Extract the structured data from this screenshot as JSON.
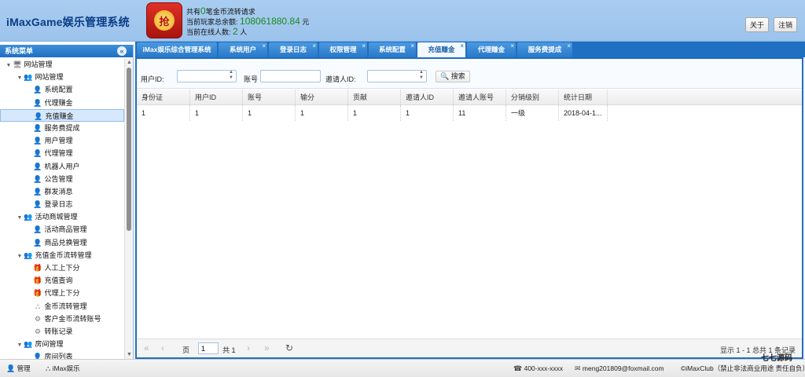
{
  "header": {
    "title": "iMaxGame娱乐管理系统",
    "logo_char": "抢",
    "stats": {
      "line1_prefix": "共有",
      "line1_num": "0",
      "line1_suffix": "笔金币流转请求",
      "line2_prefix": "当前玩家总余额:",
      "line2_num": "108061880.84",
      "line2_suffix": "元",
      "line3_prefix": "当前在线人数:",
      "line3_num": "2",
      "line3_suffix": "人"
    },
    "buttons": {
      "about": "关于",
      "logout": "注销"
    }
  },
  "sidebar": {
    "title": "系统菜单",
    "collapse": "«",
    "tree": [
      {
        "label": "网站管理",
        "level": 0,
        "type": "root",
        "icon": "monitor-icon"
      },
      {
        "label": "网站管理",
        "level": 1,
        "type": "group",
        "icon": "users-icon"
      },
      {
        "label": "系统配置",
        "level": 2,
        "icon": "user-icon"
      },
      {
        "label": "代理赚金",
        "level": 2,
        "icon": "user-icon"
      },
      {
        "label": "充值赚金",
        "level": 2,
        "icon": "user-icon",
        "selected": true
      },
      {
        "label": "服务费提成",
        "level": 2,
        "icon": "user-icon"
      },
      {
        "label": "用户管理",
        "level": 2,
        "icon": "user-icon"
      },
      {
        "label": "代理管理",
        "level": 2,
        "icon": "user-icon"
      },
      {
        "label": "机器人用户",
        "level": 2,
        "icon": "user-icon"
      },
      {
        "label": "公告管理",
        "level": 2,
        "icon": "user-icon"
      },
      {
        "label": "群发消息",
        "level": 2,
        "icon": "user-icon"
      },
      {
        "label": "登录日志",
        "level": 2,
        "icon": "user-icon"
      },
      {
        "label": "活动商城管理",
        "level": 1,
        "type": "group",
        "icon": "users-icon"
      },
      {
        "label": "活动商品管理",
        "level": 2,
        "icon": "user-icon"
      },
      {
        "label": "商品兑换管理",
        "level": 2,
        "icon": "user-icon"
      },
      {
        "label": "充值金币流转管理",
        "level": 1,
        "type": "group",
        "icon": "users-icon"
      },
      {
        "label": "人工上下分",
        "level": 2,
        "icon": "gift-icon"
      },
      {
        "label": "充值查询",
        "level": 2,
        "icon": "gift-icon"
      },
      {
        "label": "代理上下分",
        "level": 2,
        "icon": "gift-icon"
      },
      {
        "label": "金币流转管理",
        "level": 2,
        "icon": "network-icon"
      },
      {
        "label": "客户金币流转账号",
        "level": 2,
        "icon": "gears-icon"
      },
      {
        "label": "转账记录",
        "level": 2,
        "icon": "gear-icon"
      },
      {
        "label": "房间管理",
        "level": 1,
        "type": "group",
        "icon": "users-icon"
      },
      {
        "label": "房间列表",
        "level": 2,
        "icon": "user-icon"
      }
    ]
  },
  "tabs": [
    {
      "label": "iMax娱乐综合管理系统",
      "closable": false
    },
    {
      "label": "系统用户",
      "closable": true
    },
    {
      "label": "登录日志",
      "closable": true
    },
    {
      "label": "权限管理",
      "closable": true
    },
    {
      "label": "系统配置",
      "closable": true
    },
    {
      "label": "充值赚金",
      "closable": true,
      "active": true
    },
    {
      "label": "代理赚金",
      "closable": true
    },
    {
      "label": "服务费提成",
      "closable": true
    }
  ],
  "filter": {
    "user_id_label": "用户ID:",
    "user_id_value": "",
    "account_label": "账号",
    "account_value": "",
    "inviter_label": "邀请人ID:",
    "inviter_value": "",
    "search_label": "搜索"
  },
  "table": {
    "columns": [
      "身份证",
      "用户ID",
      "账号",
      "输分",
      "贡献",
      "邀请人ID",
      "邀请人账号",
      "分销级别",
      "统计日期"
    ],
    "rows": [
      [
        "1",
        "1",
        "1",
        "1",
        "1",
        "1",
        "11",
        "一级",
        "2018-04-1..."
      ]
    ]
  },
  "pager": {
    "page_label": "页",
    "page_value": "1",
    "total_label": "共 1",
    "info": "显示 1 - 1 总共 1 条记录"
  },
  "footer": {
    "user": "管理",
    "company": "iMax娱乐",
    "phone": "400-xxx-xxxx",
    "email": "meng201809@foxmail.com",
    "copyright": "©iMaxClub（禁止非法商业用途 责任自负）",
    "watermark": "七七源码"
  }
}
